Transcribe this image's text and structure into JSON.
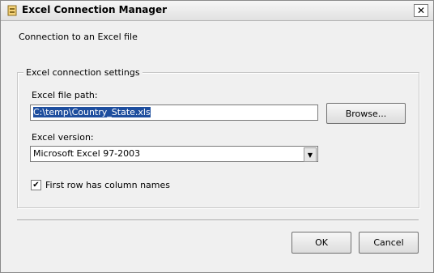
{
  "window": {
    "title": "Excel Connection Manager",
    "icon": "excel-connection-icon",
    "close_label": "✕"
  },
  "subtitle": "Connection to an Excel file",
  "group": {
    "title": "Excel connection settings",
    "file_path_label": "Excel file path:",
    "file_path_value": "C:\\temp\\Country_State.xls",
    "browse_label": "Browse...",
    "version_label": "Excel version:",
    "version_value": "Microsoft Excel 97-2003",
    "first_row_label": "First row has column names",
    "first_row_checked": true
  },
  "buttons": {
    "ok": "OK",
    "cancel": "Cancel"
  }
}
